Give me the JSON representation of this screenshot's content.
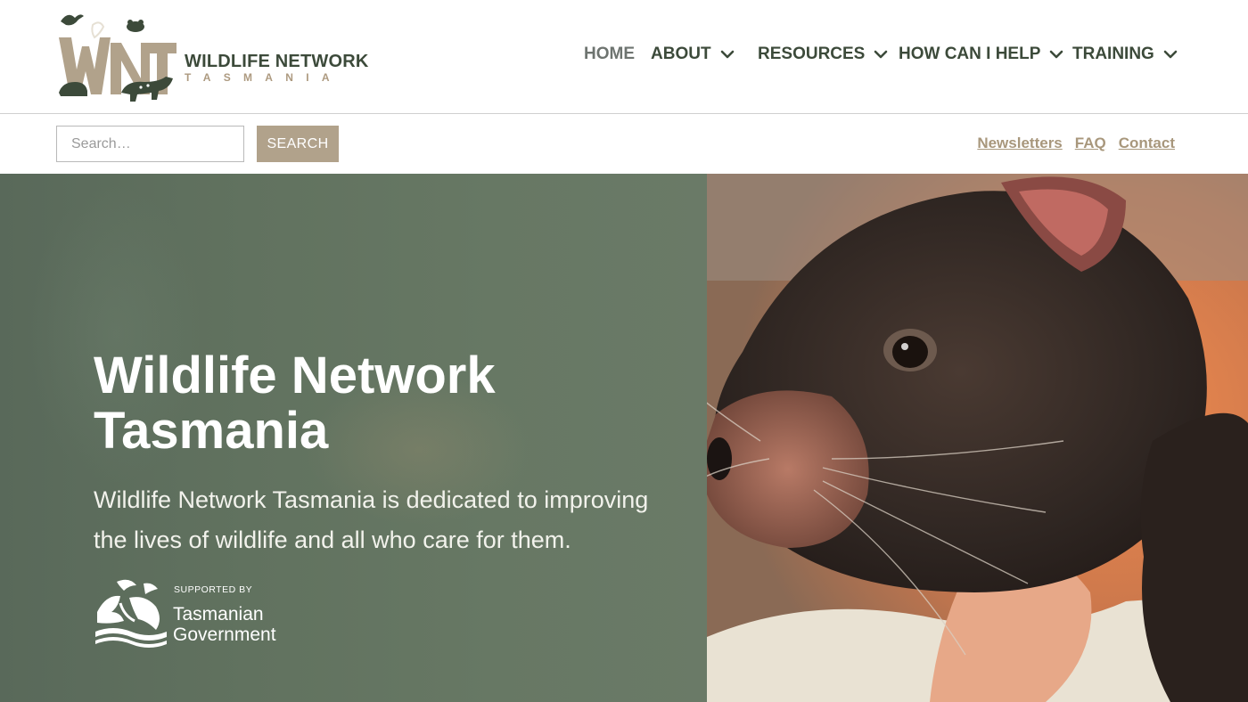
{
  "header": {
    "brand_name": "WILDLIFE NETWORK",
    "brand_sub": "TASMANIA",
    "logo_letters": "WNT",
    "logo_icon": "wnt-animals-logo-icon"
  },
  "nav": {
    "items": [
      {
        "label": "HOME",
        "has_dropdown": false,
        "active": true
      },
      {
        "label": "ABOUT",
        "has_dropdown": true
      },
      {
        "label": "RESOURCES",
        "has_dropdown": true
      },
      {
        "label": "HOW CAN I HELP",
        "has_dropdown": true
      },
      {
        "label": "TRAINING",
        "has_dropdown": true
      }
    ],
    "dropdown_icon": "chevron-down-icon"
  },
  "search": {
    "placeholder": "Search…",
    "value": "",
    "button_label": "SEARCH"
  },
  "utility_links": {
    "newsletters": "Newsletters",
    "faq": "FAQ",
    "contact": "Contact"
  },
  "hero": {
    "title": "Wildlife Network Tasmania",
    "description": "Wildlife Network Tasmania is dedicated to improving the lives of wildlife and all who care for them.",
    "image": "tasmanian-devil-photo"
  },
  "supporter": {
    "supported_by": "SUPPORTED BY",
    "name_line1": "Tasmanian",
    "name_line2": "Government",
    "emblem_icon": "tasmanian-government-emblem-icon"
  },
  "colors": {
    "brand_green": "#3c4a3a",
    "brand_tan": "#b1a28b",
    "link_tan": "#a8977c",
    "hero_green": "#61725f",
    "white": "#ffffff"
  }
}
